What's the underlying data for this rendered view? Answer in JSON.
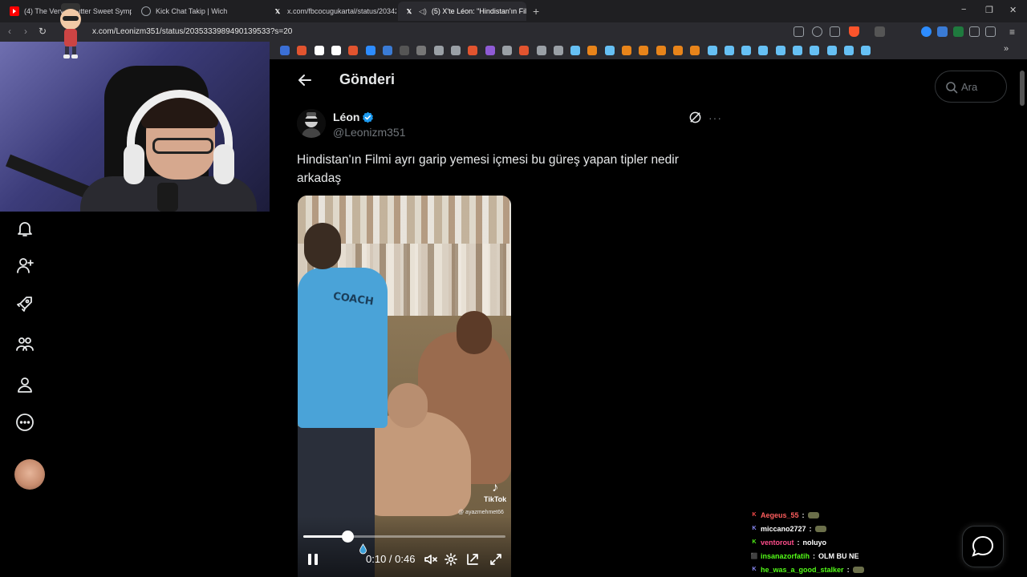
{
  "browser": {
    "tabs": [
      {
        "title": "(4) The Verve - Bitter Sweet Symphony",
        "favicon": "youtube-icon",
        "color": "#ff0000"
      },
      {
        "title": "Kick Chat Takip | Wich",
        "favicon": "globe-icon",
        "color": "#9aa0a6"
      },
      {
        "title": "x.com/fbcocugukartal/status/203425",
        "favicon": "x-icon",
        "color": "#ffffff"
      },
      {
        "title": "(5) X'te Léon: \"Hindistan'ın Fil",
        "favicon": "x-icon",
        "color": "#ffffff"
      }
    ],
    "new_tab": "+",
    "window_controls": {
      "minimize": "−",
      "maximize": "❐",
      "close": "✕"
    },
    "url": "x.com/Leonizm351/status/2035333989490139533?s=20",
    "bookmarks_more": "»"
  },
  "sidebar": {
    "items": [
      {
        "name": "notifications-icon"
      },
      {
        "name": "follow-icon"
      },
      {
        "name": "rocket-icon"
      },
      {
        "name": "communities-icon"
      },
      {
        "name": "profile-icon"
      },
      {
        "name": "more-icon"
      }
    ]
  },
  "header": {
    "title": "Gönderi",
    "back": "←"
  },
  "search": {
    "placeholder": "Ara"
  },
  "post": {
    "author_name": "Léon",
    "author_handle": "@Leonizm351",
    "text": "Hindistan'ın Filmi ayrı garip yemesi içmesi bu güreş yapan tipler nedir arkadaş",
    "more": "···",
    "video": {
      "overlay_label": "COACH",
      "watermark": "TikTok",
      "watermark_user": "@ ayazmehmet66",
      "current_time": "0:10",
      "duration": "0:46",
      "time_display": "0:10 / 0:46",
      "progress": 0.217
    }
  },
  "chat": [
    {
      "user": "Aegeus_55",
      "user_color": "#ff5e5e",
      "badge": "K",
      "badge_color": "#ff4d4d",
      "message": "",
      "emote": true
    },
    {
      "user": "miccano2727",
      "user_color": "#ffffff",
      "badge": "K",
      "badge_color": "#8f8fff",
      "message": "",
      "emote": true
    },
    {
      "user": "ventorout",
      "user_color": "#ff4d8b",
      "badge": "K",
      "badge_color": "#53fc18",
      "message": "noluyo",
      "emote": false
    },
    {
      "user": "insanazorfatih",
      "user_color": "#53fc18",
      "badge": "⬛",
      "badge_color": "#53fc18",
      "message": "OLM BU NE",
      "emote": false
    },
    {
      "user": "he_was_a_good_stalker",
      "user_color": "#53fc18",
      "badge": "K",
      "badge_color": "#8f8fff",
      "message": "",
      "emote": true
    }
  ],
  "colors": {
    "background": "#000000",
    "text": "#e7e9ea",
    "muted": "#71767b",
    "verified": "#1d9bf0",
    "border": "#2f3336"
  }
}
